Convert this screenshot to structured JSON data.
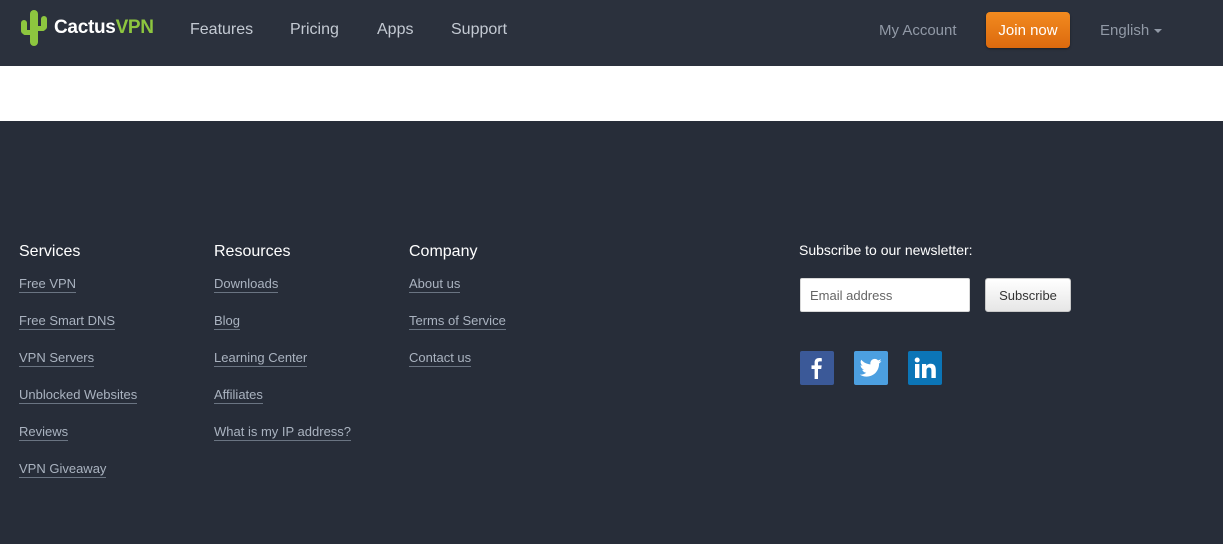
{
  "header": {
    "logo_main": "Cactus",
    "logo_accent": "VPN",
    "nav": [
      "Features",
      "Pricing",
      "Apps",
      "Support"
    ],
    "my_account": "My Account",
    "join": "Join now",
    "language": "English"
  },
  "footer": {
    "columns": [
      {
        "title": "Services",
        "links": [
          "Free VPN",
          "Free Smart DNS",
          "VPN Servers",
          "Unblocked Websites",
          "Reviews",
          "VPN Giveaway"
        ]
      },
      {
        "title": "Resources",
        "links": [
          "Downloads",
          "Blog",
          "Learning Center",
          "Affiliates",
          "What is my IP address?"
        ]
      },
      {
        "title": "Company",
        "links": [
          "About us",
          "Terms of Service",
          "Contact us"
        ]
      }
    ],
    "newsletter": {
      "title": "Subscribe to our newsletter:",
      "placeholder": "Email address",
      "button": "Subscribe"
    },
    "social": [
      "facebook-icon",
      "twitter-icon",
      "linkedin-icon"
    ]
  },
  "colors": {
    "header_bg": "#2b313d",
    "footer_bg": "#272d39",
    "accent_green": "#8dc63f",
    "join_orange": "#e8771a"
  }
}
